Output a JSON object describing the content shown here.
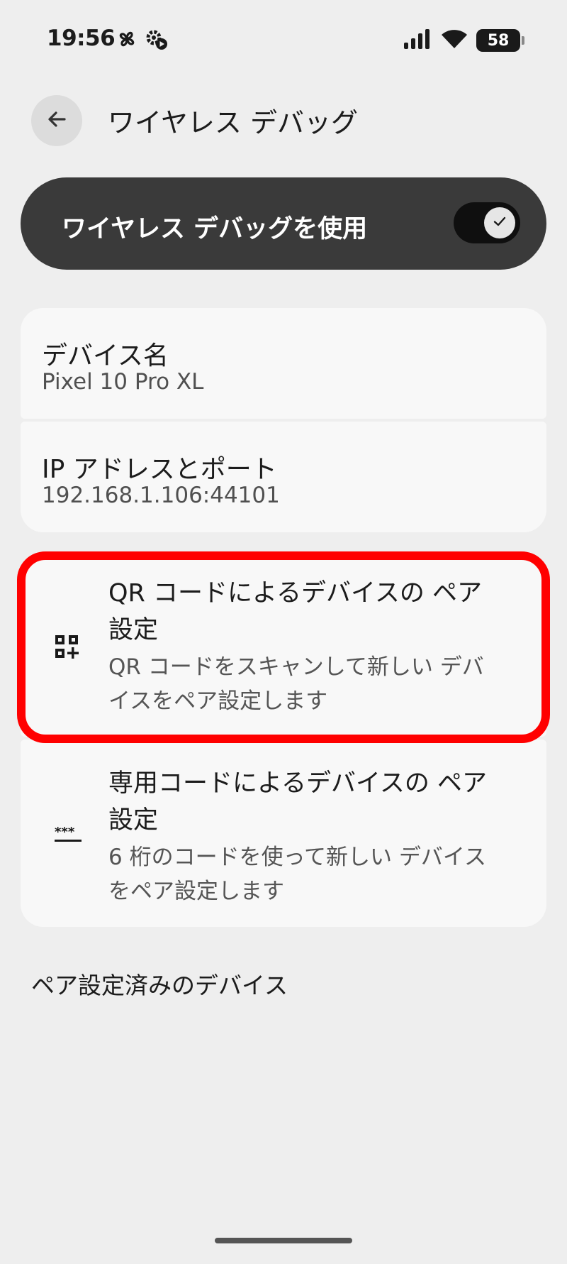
{
  "status_bar": {
    "time": "19:56",
    "battery_level": "58",
    "icons": [
      "pinwheel-icon",
      "gear-record-icon",
      "signal-icon",
      "wifi-icon",
      "battery-icon"
    ]
  },
  "header": {
    "back_icon": "arrow-left-icon",
    "title": "ワイヤレス デバッグ"
  },
  "master_toggle": {
    "label": "ワイヤレス デバッグを使用",
    "enabled": true
  },
  "device_info": {
    "name_label": "デバイス名",
    "name_value": "Pixel 10 Pro XL",
    "ip_label": "IP アドレスとポート",
    "ip_value": "192.168.1.106:44101"
  },
  "pairing": {
    "qr": {
      "icon": "qr-code-add-icon",
      "title": "QR コードによるデバイスの ペア設定",
      "subtitle": "QR コードをスキャンして新しい デバイスをペア設定します"
    },
    "code": {
      "icon": "password-icon",
      "title": "専用コードによるデバイスの ペア設定",
      "subtitle": "6 桁のコードを使って新しい デバイスをペア設定します"
    }
  },
  "paired_devices": {
    "header": "ペア設定済みのデバイス"
  },
  "colors": {
    "background": "#eeeeee",
    "card": "#f8f8f8",
    "master_card": "#3a3a3a",
    "highlight": "#ff0000"
  }
}
